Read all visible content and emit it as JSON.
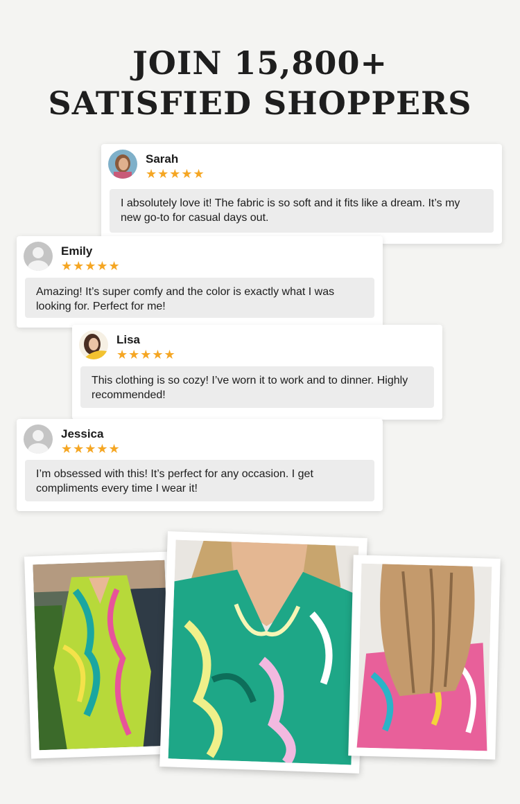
{
  "headline": {
    "line1": "JOIN 15,800+",
    "line2": "SATISFIED SHOPPERS"
  },
  "reviews": [
    {
      "name": "Sarah",
      "stars": "★★★★★",
      "rating": 5,
      "avatar": "photo-avatar",
      "text": "I absolutely love it! The fabric is so soft and it fits like a dream. It’s my new go-to for casual days out."
    },
    {
      "name": "Emily",
      "stars": "★★★★★",
      "rating": 5,
      "avatar": "default-avatar",
      "text": "Amazing! It’s super comfy and the color is exactly what I was looking for. Perfect for me!"
    },
    {
      "name": "Lisa",
      "stars": "★★★★★",
      "rating": 5,
      "avatar": "photo-avatar",
      "text": "This clothing is so cozy! I’ve worn it to work and to dinner. Highly recommended!"
    },
    {
      "name": "Jessica",
      "stars": "★★★★★",
      "rating": 5,
      "avatar": "default-avatar",
      "text": "I’m obsessed with this! It’s perfect for any occasion. I get compliments every time I wear it!"
    }
  ],
  "colors": {
    "background": "#f4f4f2",
    "star": "#f5a623",
    "bubble": "#ececec",
    "headline": "#1e1e1e"
  },
  "photos": [
    {
      "subject": "model-in-yellow-green-paisley-dress"
    },
    {
      "subject": "teal-paisley-v-neck-closeup"
    },
    {
      "subject": "pink-paisley-back-view"
    }
  ]
}
